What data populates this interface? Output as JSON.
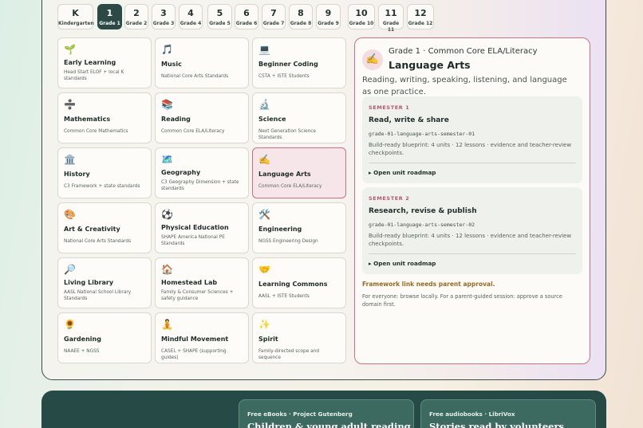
{
  "grades": [
    {
      "big": "K",
      "small": "Kindergarten",
      "active": false
    },
    {
      "big": "1",
      "small": "Grade 1",
      "active": true
    },
    {
      "big": "2",
      "small": "Grade 2",
      "active": false
    },
    {
      "big": "3",
      "small": "Grade 3",
      "active": false
    },
    {
      "big": "4",
      "small": "Grade 4",
      "active": false
    },
    {
      "big": "5",
      "small": "Grade 5",
      "active": false
    },
    {
      "big": "6",
      "small": "Grade 6",
      "active": false
    },
    {
      "big": "7",
      "small": "Grade 7",
      "active": false
    },
    {
      "big": "8",
      "small": "Grade 8",
      "active": false
    },
    {
      "big": "9",
      "small": "Grade 9",
      "active": false
    },
    {
      "big": "10",
      "small": "Grade 10",
      "active": false
    },
    {
      "big": "11",
      "small": "Grade 11",
      "active": false
    },
    {
      "big": "12",
      "small": "Grade 12",
      "active": false
    }
  ],
  "subjects": [
    {
      "icon": "🌱",
      "icon_name": "seedling-icon",
      "title": "Early Learning",
      "sub": "Head Start ELOF + local K standards"
    },
    {
      "icon": "🎵",
      "icon_name": "music-note-icon",
      "title": "Music",
      "sub": "National Core Arts Standards"
    },
    {
      "icon": "💻",
      "icon_name": "laptop-icon",
      "title": "Beginner Coding",
      "sub": "CSTA + ISTE Students"
    },
    {
      "icon": "➗",
      "icon_name": "divide-icon",
      "title": "Mathematics",
      "sub": "Common Core Mathematics"
    },
    {
      "icon": "📚",
      "icon_name": "books-icon",
      "title": "Reading",
      "sub": "Common Core ELA/Literacy"
    },
    {
      "icon": "🔬",
      "icon_name": "microscope-icon",
      "title": "Science",
      "sub": "Next Generation Science Standards"
    },
    {
      "icon": "🏛️",
      "icon_name": "classical-building-icon",
      "title": "History",
      "sub": "C3 Framework + state standards"
    },
    {
      "icon": "🗺️",
      "icon_name": "map-icon",
      "title": "Geography",
      "sub": "C3 Geography Dimension + state standards"
    },
    {
      "icon": "✍️",
      "icon_name": "writing-hand-icon",
      "title": "Language Arts",
      "sub": "Common Core ELA/Literacy",
      "active": true
    },
    {
      "icon": "🎨",
      "icon_name": "palette-icon",
      "title": "Art & Creativity",
      "sub": "National Core Arts Standards"
    },
    {
      "icon": "⚽",
      "icon_name": "soccer-ball-icon",
      "title": "Physical Education",
      "sub": "SHAPE America National PE Standards"
    },
    {
      "icon": "🛠️",
      "icon_name": "tools-icon",
      "title": "Engineering",
      "sub": "NGSS Engineering Design"
    },
    {
      "icon": "🔎",
      "icon_name": "magnifier-icon",
      "title": "Living Library",
      "sub": "AASL National School Library Standards"
    },
    {
      "icon": "🏠",
      "icon_name": "house-icon",
      "title": "Homestead Lab",
      "sub": "Family & Consumer Sciences + safety guidance"
    },
    {
      "icon": "🤝",
      "icon_name": "handshake-icon",
      "title": "Learning Commons",
      "sub": "AASL + ISTE Students"
    },
    {
      "icon": "🌻",
      "icon_name": "sunflower-icon",
      "title": "Gardening",
      "sub": "NAAEE + NGSS"
    },
    {
      "icon": "🧘",
      "icon_name": "meditation-icon",
      "title": "Mindful Movement",
      "sub": "CASEL + SHAPE (supporting guides)"
    },
    {
      "icon": "✨",
      "icon_name": "sparkles-icon",
      "title": "Spirit",
      "sub": "Family-directed scope and sequence"
    }
  ],
  "detail": {
    "icon": "✍️",
    "meta": "Grade 1 · Common Core ELA/Literacy",
    "title": "Language Arts",
    "description": "Reading, writing, speaking, listening, and language as one practice.",
    "semesters": [
      {
        "label": "SEMESTER 1",
        "title": "Read, write & share",
        "code": "grade-01-language-arts-semester-01",
        "desc": "Build-ready blueprint: 4 units · 12 lessons · evidence and teacher-review checkpoints.",
        "link": "▸ Open unit roadmap"
      },
      {
        "label": "SEMESTER 2",
        "title": "Research, revise & publish",
        "code": "grade-01-language-arts-semester-02",
        "desc": "Build-ready blueprint: 4 units · 12 lessons · evidence and teacher-review checkpoints.",
        "link": "▸ Open unit roadmap"
      }
    ],
    "warning": "Framework link needs parent approval.",
    "note": "For everyone: browse locally. For a parent-guided session: approve a source domain first."
  },
  "footer": {
    "cards": [
      {
        "label": "Free eBooks · Project Gutenberg",
        "title": "Children & young adult reading"
      },
      {
        "label": "Free audiobooks · LibriVox",
        "title": "Stories read by volunteers"
      }
    ]
  },
  "colors": {
    "accent_dark": "#2b4a45",
    "accent_pink": "#c96f8a",
    "warning": "#9b6a1d"
  }
}
